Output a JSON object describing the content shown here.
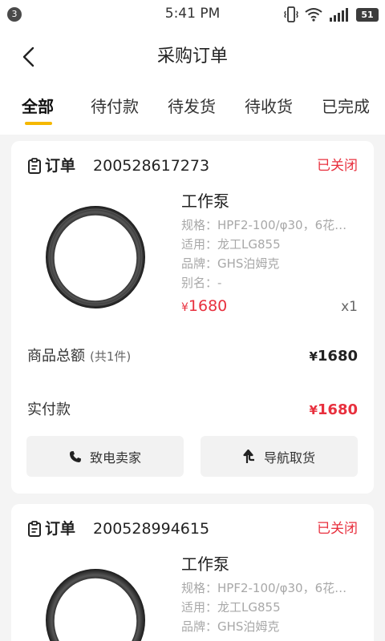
{
  "status_bar": {
    "notification_count": "3",
    "time": "5:41 PM",
    "battery": "51",
    "icons": [
      "vibrate-icon",
      "wifi-icon",
      "signal-icon",
      "battery-icon"
    ]
  },
  "header": {
    "title": "采购订单",
    "back_icon": "chevron-left-icon"
  },
  "tabs": [
    {
      "label": "全部",
      "active": true
    },
    {
      "label": "待付款",
      "active": false
    },
    {
      "label": "待发货",
      "active": false
    },
    {
      "label": "待收货",
      "active": false
    },
    {
      "label": "已完成",
      "active": false
    }
  ],
  "colors": {
    "accent": "#f5b800",
    "status_red": "#e8303e",
    "background": "#f4f4f4"
  },
  "orders": [
    {
      "label": "订单",
      "number": "200528617273",
      "status": "已关闭",
      "product": {
        "name": "工作泵",
        "spec": "规格：HPF2-100/φ30，6花…",
        "fit": "适用：龙工LG855",
        "brand": "品牌：GHS泊姆克",
        "alias": "别名：-",
        "currency": "¥",
        "price": "1680",
        "qty": "x1"
      },
      "total_label": "商品总额",
      "total_count": "(共1件)",
      "total_currency": "¥",
      "total_value": "1680",
      "paid_label": "实付款",
      "paid_currency": "¥",
      "paid_value": "1680",
      "actions": [
        {
          "label": "致电卖家",
          "icon": "phone-icon"
        },
        {
          "label": "导航取货",
          "icon": "navigation-arrow-icon"
        }
      ]
    },
    {
      "label": "订单",
      "number": "200528994615",
      "status": "已关闭",
      "product": {
        "name": "工作泵",
        "spec": "规格：HPF2-100/φ30，6花…",
        "fit": "适用：龙工LG855",
        "brand": "品牌：GHS泊姆克"
      }
    }
  ]
}
